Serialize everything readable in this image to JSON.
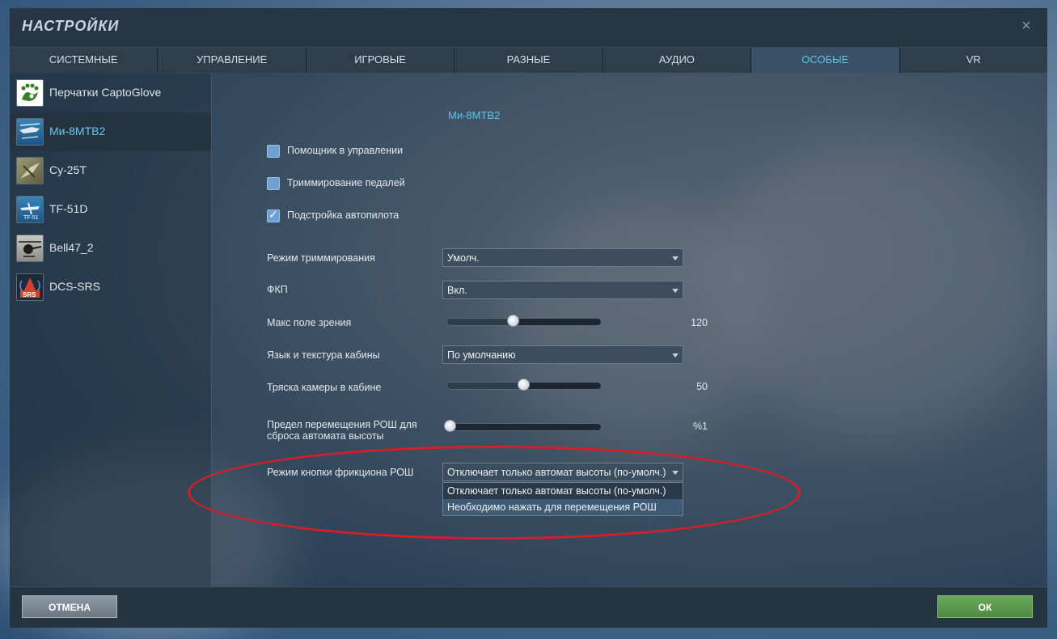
{
  "window": {
    "title": "НАСТРОЙКИ",
    "close": "×"
  },
  "tabs": [
    {
      "label": "СИСТЕМНЫЕ"
    },
    {
      "label": "УПРАВЛЕНИЕ"
    },
    {
      "label": "ИГРОВЫЕ"
    },
    {
      "label": "РАЗНЫЕ"
    },
    {
      "label": "АУДИО"
    },
    {
      "label": "ОСОБЫЕ",
      "active": true
    },
    {
      "label": "VR"
    }
  ],
  "sidebar": {
    "items": [
      {
        "label": "Перчатки CaptoGlove",
        "icon": "captoglove-logo-icon"
      },
      {
        "label": "Ми-8МТВ2",
        "icon": "mi8-module-icon",
        "active": true
      },
      {
        "label": "Су-25Т",
        "icon": "su25t-module-icon"
      },
      {
        "label": "TF-51D",
        "icon": "tf51d-module-icon"
      },
      {
        "label": "Bell47_2",
        "icon": "bell47-module-icon"
      },
      {
        "label": "DCS-SRS",
        "icon": "srs-logo-icon"
      }
    ]
  },
  "main": {
    "module_title": "Ми-8МТВ2",
    "checkboxes": [
      {
        "label": "Помощник в управлении",
        "checked": false
      },
      {
        "label": "Триммирование педалей",
        "checked": false
      },
      {
        "label": "Подстройка автопилота",
        "checked": true
      }
    ],
    "trim_mode": {
      "label": "Режим триммирования",
      "value": "Умолч."
    },
    "fkp": {
      "label": "ФКП",
      "value": "Вкл."
    },
    "max_fov": {
      "label": "Макс поле зрения",
      "value": "120",
      "level": 0.43
    },
    "cockpit_lang": {
      "label": "Язык и текстура кабины",
      "value": "По умолчанию"
    },
    "camera_shake": {
      "label": "Тряска камеры в кабине",
      "value": "50",
      "level": 0.5
    },
    "rosh_limit": {
      "label_line1": "Предел перемещения РОШ для",
      "label_line2": "сброса автомата высоты",
      "value": "1",
      "unit": "%",
      "level": 0.02
    },
    "friction_mode": {
      "label": "Режим кнопки фрикциона РОШ",
      "value": "Отключает только автомат высоты (по-умолч.)",
      "options": [
        "Отключает только автомат высоты (по-умолч.)",
        "Необходимо нажать для перемещения РОШ"
      ]
    }
  },
  "buttons": {
    "cancel": "ОТМЕНА",
    "ok": "ОК"
  },
  "colors": {
    "accent": "#5ec4e8",
    "annotation": "#d51f28",
    "ok": "#5b9a4d"
  }
}
